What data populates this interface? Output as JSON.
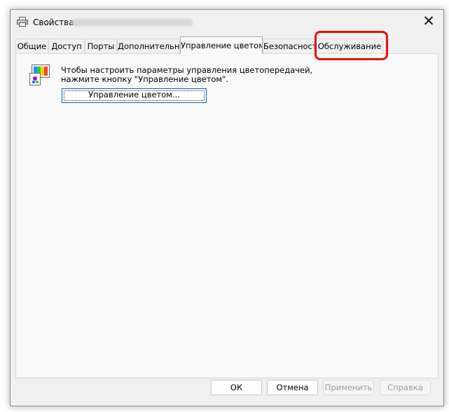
{
  "window": {
    "title": "Свойства:",
    "close_glyph": "✕",
    "icons": {
      "app": "printer-icon",
      "close": "close-icon",
      "content": "color-management-icon"
    }
  },
  "tabs": [
    {
      "label": "Общие",
      "active": false
    },
    {
      "label": "Доступ",
      "active": false
    },
    {
      "label": "Порты",
      "active": false
    },
    {
      "label": "Дополнительно",
      "active": false
    },
    {
      "label": "Управление цветом",
      "active": true
    },
    {
      "label": "Безопасность",
      "active": false
    },
    {
      "label": "Обслуживание",
      "active": false
    }
  ],
  "content": {
    "description_line1": "Чтобы настроить параметры управления цветопередачей,",
    "description_line2": "нажмите кнопку \"Управление цветом\".",
    "color_button": "Управление цветом..."
  },
  "footer": {
    "ok": "ОК",
    "cancel": "Отмена",
    "apply": "Применить",
    "help": "Справка"
  },
  "annotation": {
    "color": "#e81010",
    "target": "Обслуживание"
  }
}
